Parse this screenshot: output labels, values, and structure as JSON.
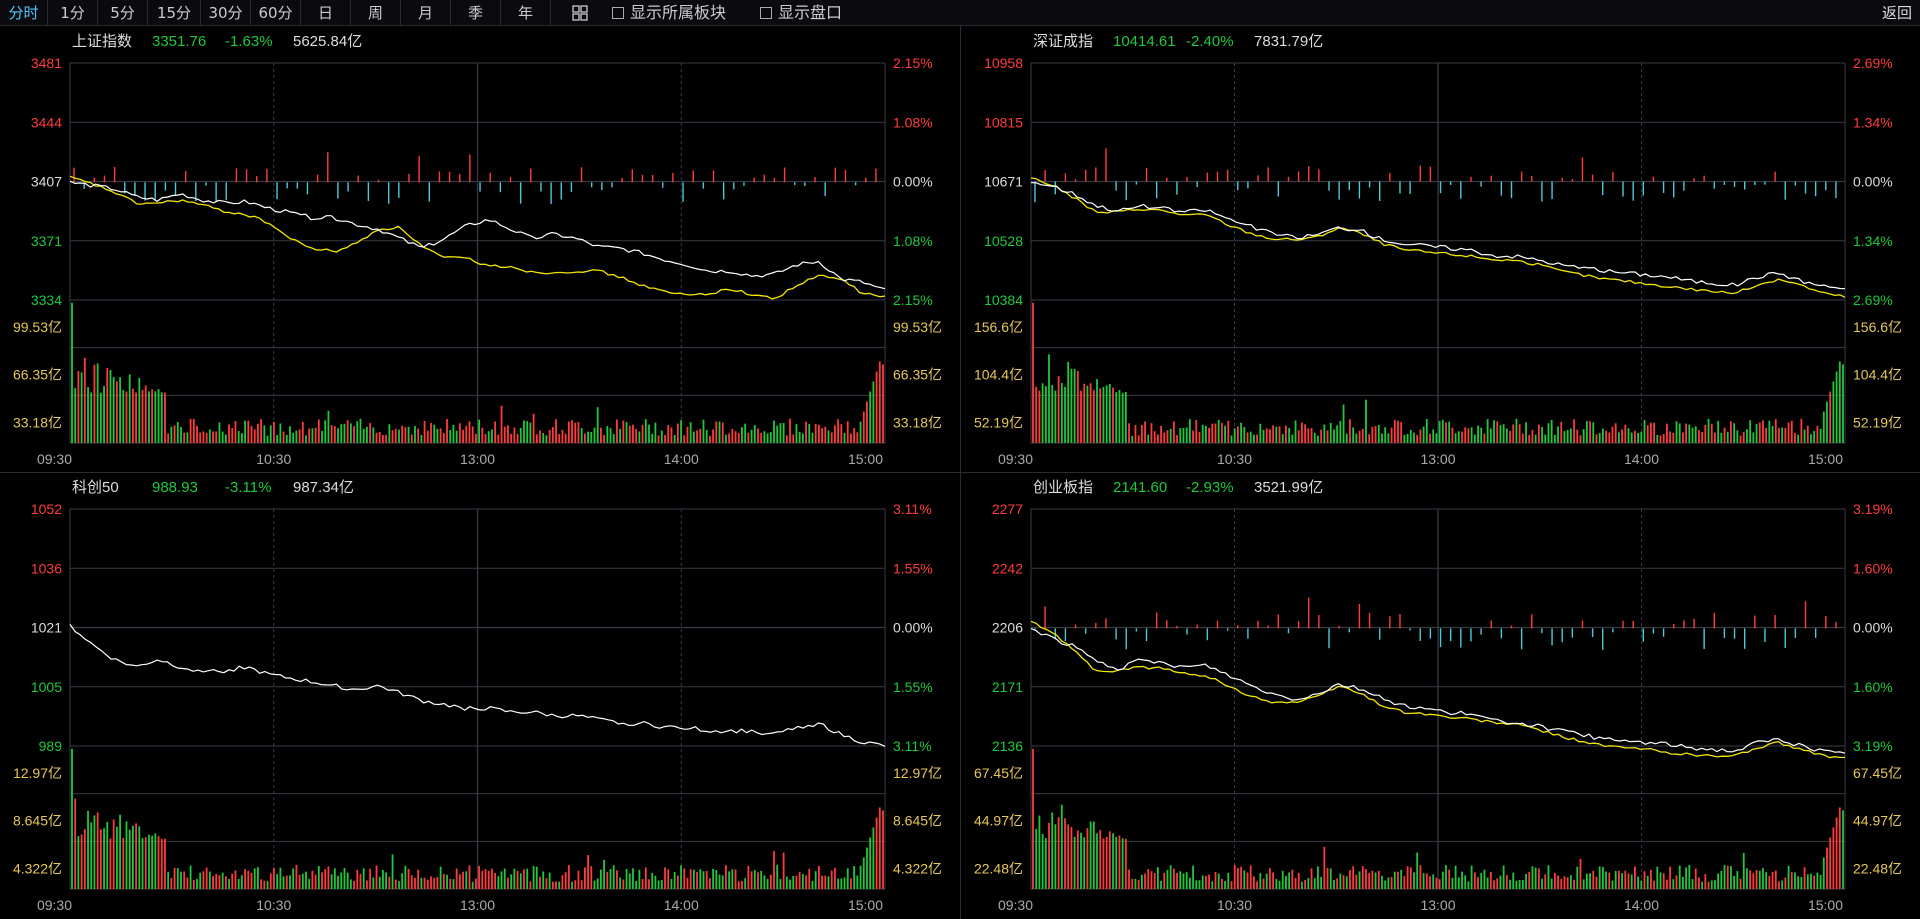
{
  "toolbar": {
    "buttons": [
      "分时",
      "1分",
      "5分",
      "15分",
      "30分",
      "60分",
      "日",
      "周",
      "月",
      "季",
      "年"
    ],
    "active": "分时",
    "checkbox_blocks": "显示所属板块",
    "checkbox_orderbook": "显示盘口",
    "back": "返回"
  },
  "colors": {
    "up": "#ff3c3c",
    "down": "#1fc93c",
    "price": "#ffffff",
    "avg": "#f2e600",
    "bar_down": "#4ec9d8",
    "grid": "#3a3a46",
    "vol_label": "#e6c85a"
  },
  "time_labels": [
    "09:30",
    "10:30",
    "13:00",
    "14:00",
    "15:00"
  ],
  "chart_data": [
    {
      "type": "line",
      "name": "上证指数",
      "price": "3351.76",
      "change": "-1.63%",
      "turnover": "5625.84亿",
      "y_labels_left": [
        "3481",
        "3444",
        "3407",
        "3371",
        "3334"
      ],
      "y_labels_right": [
        "2.15%",
        "1.08%",
        "0.00%",
        "1.08%",
        "2.15%"
      ],
      "vol_labels": [
        "99.53亿",
        "66.35亿",
        "33.18亿"
      ],
      "ylim": [
        3334,
        3481
      ],
      "prev_close": 3407,
      "has_avg": true,
      "seed": 11,
      "price_points": [
        3407,
        3405,
        3403,
        3398,
        3396,
        3400,
        3396,
        3394,
        3395,
        3391,
        3388,
        3385,
        3385,
        3381,
        3378,
        3372,
        3366,
        3372,
        3380,
        3384,
        3378,
        3372,
        3375,
        3372,
        3367,
        3366,
        3363,
        3359,
        3356,
        3352,
        3352,
        3349,
        3350,
        3356,
        3358,
        3347,
        3345,
        3340
      ],
      "avg_points": [
        3410,
        3406,
        3401,
        3394,
        3394,
        3396,
        3393,
        3389,
        3387,
        3382,
        3372,
        3366,
        3364,
        3369,
        3378,
        3379,
        3367,
        3360,
        3360,
        3355,
        3355,
        3351,
        3351,
        3352,
        3352,
        3348,
        3343,
        3339,
        3337,
        3338,
        3341,
        3337,
        3335,
        3343,
        3349,
        3347,
        3338,
        3336
      ]
    },
    {
      "type": "line",
      "name": "深证成指",
      "price": "10414.61",
      "change": "-2.40%",
      "turnover": "7831.79亿",
      "y_labels_left": [
        "10958",
        "10815",
        "10671",
        "10528",
        "10384"
      ],
      "y_labels_right": [
        "2.69%",
        "1.34%",
        "0.00%",
        "1.34%",
        "2.69%"
      ],
      "vol_labels": [
        "156.6亿",
        "104.4亿",
        "52.19亿"
      ],
      "ylim": [
        10384,
        10958
      ],
      "prev_close": 10671,
      "has_avg": true,
      "seed": 23,
      "price_points": [
        10671,
        10660,
        10640,
        10612,
        10600,
        10612,
        10605,
        10598,
        10602,
        10580,
        10562,
        10545,
        10535,
        10542,
        10560,
        10552,
        10530,
        10520,
        10515,
        10510,
        10505,
        10492,
        10490,
        10482,
        10470,
        10462,
        10455,
        10450,
        10445,
        10440,
        10430,
        10425,
        10420,
        10440,
        10450,
        10430,
        10418,
        10412
      ],
      "avg_points": [
        10680,
        10662,
        10630,
        10595,
        10598,
        10605,
        10600,
        10590,
        10590,
        10565,
        10545,
        10532,
        10530,
        10536,
        10560,
        10545,
        10520,
        10505,
        10500,
        10495,
        10490,
        10482,
        10480,
        10470,
        10455,
        10445,
        10435,
        10430,
        10423,
        10417,
        10410,
        10405,
        10400,
        10420,
        10435,
        10420,
        10400,
        10392
      ]
    },
    {
      "type": "line",
      "name": "科创50",
      "price": "988.93",
      "change": "-3.11%",
      "turnover": "987.34亿",
      "y_labels_left": [
        "1052",
        "1036",
        "1021",
        "1005",
        "989"
      ],
      "y_labels_right": [
        "3.11%",
        "1.55%",
        "0.00%",
        "1.55%",
        "3.11%"
      ],
      "vol_labels": [
        "12.97亿",
        "8.645亿",
        "4.322亿"
      ],
      "ylim": [
        989,
        1052
      ],
      "prev_close": 1021,
      "has_avg": false,
      "seed": 37,
      "price_points": [
        1021,
        1016,
        1012,
        1010,
        1012,
        1010,
        1009,
        1009,
        1010,
        1008,
        1007,
        1006,
        1005,
        1004,
        1005,
        1003,
        1001,
        1000,
        999,
        999,
        998,
        998,
        997,
        997,
        996,
        995,
        995,
        994,
        994,
        993,
        993,
        993,
        992,
        994,
        995,
        992,
        990,
        989
      ]
    },
    {
      "type": "line",
      "name": "创业板指",
      "price": "2141.60",
      "change": "-2.93%",
      "turnover": "3521.99亿",
      "y_labels_left": [
        "2277",
        "2242",
        "2206",
        "2171",
        "2136"
      ],
      "y_labels_right": [
        "3.19%",
        "1.60%",
        "0.00%",
        "1.60%",
        "3.19%"
      ],
      "vol_labels": [
        "67.45亿",
        "44.97亿",
        "22.48亿"
      ],
      "ylim": [
        2136,
        2277
      ],
      "prev_close": 2206,
      "has_avg": true,
      "seed": 53,
      "price_points": [
        2206,
        2200,
        2195,
        2186,
        2182,
        2187,
        2185,
        2183,
        2184,
        2178,
        2172,
        2167,
        2164,
        2167,
        2173,
        2170,
        2164,
        2160,
        2158,
        2156,
        2155,
        2151,
        2150,
        2148,
        2145,
        2143,
        2140,
        2139,
        2138,
        2137,
        2135,
        2134,
        2133,
        2138,
        2140,
        2136,
        2133,
        2131
      ],
      "avg_points": [
        2210,
        2203,
        2193,
        2180,
        2181,
        2183,
        2182,
        2179,
        2178,
        2171,
        2166,
        2162,
        2162,
        2165,
        2172,
        2167,
        2160,
        2156,
        2155,
        2153,
        2152,
        2150,
        2149,
        2146,
        2142,
        2139,
        2136,
        2135,
        2134,
        2132,
        2131,
        2130,
        2130,
        2135,
        2138,
        2134,
        2130,
        2129
      ]
    }
  ]
}
